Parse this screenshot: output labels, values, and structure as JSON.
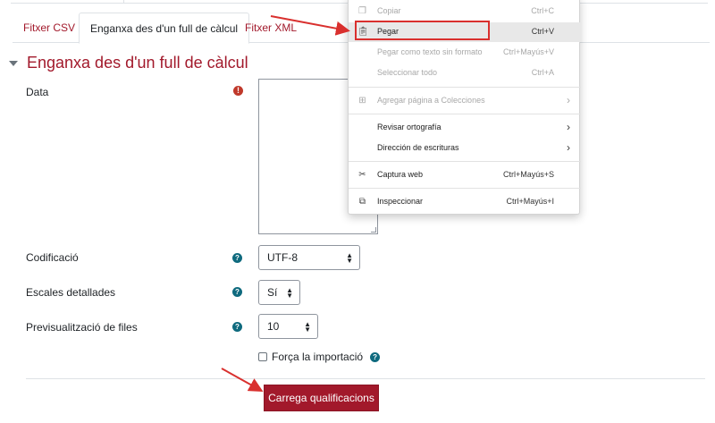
{
  "tabs": [
    {
      "label": "Fitxer CSV"
    },
    {
      "label": "Enganxa des d'un full de càlcul"
    },
    {
      "label": "Fitxer XML"
    }
  ],
  "section": {
    "title": "Enganxa des d'un full de càlcul"
  },
  "form": {
    "data_label": "Data",
    "codification_label": "Codificació",
    "codification_value": "UTF-8",
    "scales_label": "Escales detallades",
    "scales_value": "Sí",
    "preview_label": "Previsualització de files",
    "preview_value": "10",
    "force_label": "Força la importació",
    "submit_label": "Carrega qualificacions"
  },
  "context_menu": {
    "items": [
      {
        "label": "Copiar",
        "shortcut": "Ctrl+C",
        "icon": "copy-icon"
      },
      {
        "label": "Pegar",
        "shortcut": "Ctrl+V",
        "icon": "paste-icon"
      },
      {
        "label": "Pegar como texto sin formato",
        "shortcut": "Ctrl+Mayús+V"
      },
      {
        "label": "Seleccionar todo",
        "shortcut": "Ctrl+A"
      },
      {
        "label": "Agregar página a Colecciones",
        "icon": "collections-icon"
      },
      {
        "label": "Revisar ortografía"
      },
      {
        "label": "Dirección de escrituras"
      },
      {
        "label": "Captura web",
        "shortcut": "Ctrl+Mayús+S",
        "icon": "web-capture-icon"
      },
      {
        "label": "Inspeccionar",
        "shortcut": "Ctrl+Mayús+I",
        "icon": "inspect-icon"
      }
    ]
  },
  "colors": {
    "accent": "#a2192b",
    "help": "#0f6a7e",
    "annotation": "#d9302e"
  }
}
